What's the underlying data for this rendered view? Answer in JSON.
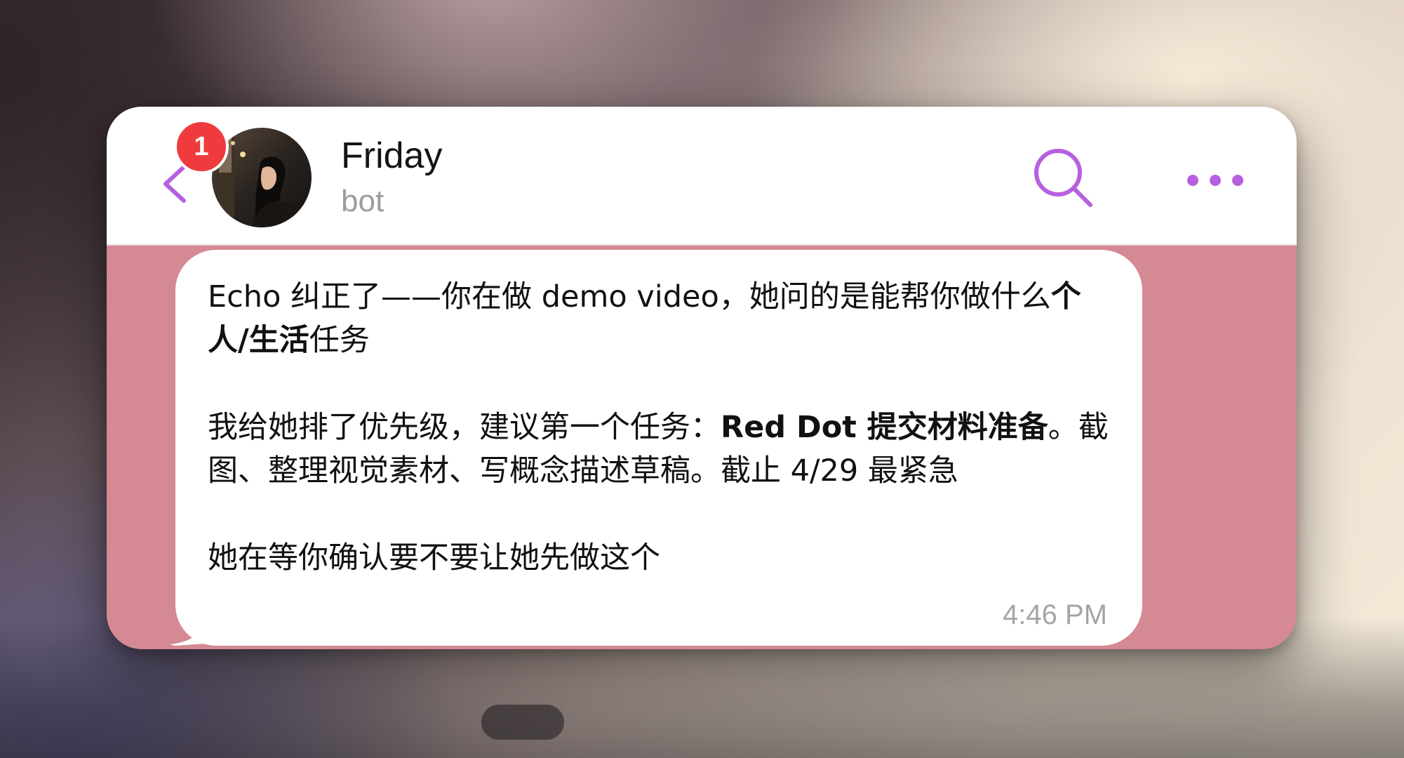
{
  "header": {
    "unread_badge": "1",
    "contact_name": "Friday",
    "contact_subtitle": "bot",
    "icons": [
      "back-chevron-icon",
      "search-icon",
      "more-dots-icon"
    ]
  },
  "message": {
    "p1_a": "Echo 纠正了——你在做 demo video，她问的是能帮你做什么",
    "p1_bold": "个人/生活",
    "p1_b": "任务",
    "p2_a": "我给她排了优先级，建议第一个任务：",
    "p2_bold": "Red Dot 提交材料准备",
    "p2_b": "。截图、整理视觉素材、写概念描述草稿。截止 4/29 最紧急",
    "p3": "她在等你确认要不要让她先做这个",
    "time": "4:46 PM"
  },
  "colors": {
    "accent": "#b65fe0",
    "badge": "#ef3b3d",
    "chat_background": "#d48993",
    "bubble": "#ffffff"
  }
}
